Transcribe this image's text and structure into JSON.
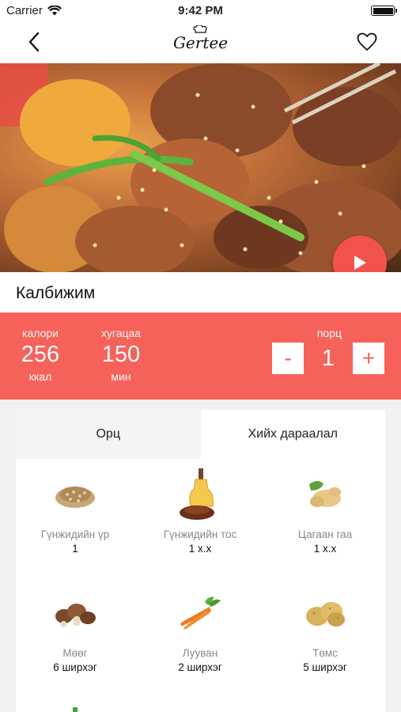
{
  "status_bar": {
    "carrier": "Carrier",
    "time": "9:42 PM"
  },
  "nav": {
    "logo_text": "Gertee"
  },
  "recipe": {
    "title": "Калбижим"
  },
  "stats": {
    "calorie_label": "калори",
    "calorie_value": "256",
    "calorie_unit": "ккал",
    "time_label": "хугацаа",
    "time_value": "150",
    "time_unit": "мин",
    "portion_label": "порц",
    "portion_value": "1",
    "minus_label": "-",
    "plus_label": "+"
  },
  "tabs": [
    {
      "label": "Орц",
      "active": true
    },
    {
      "label": "Хийх дараалал",
      "active": false
    }
  ],
  "ingredients": [
    {
      "name": "Гүнжидийн үр",
      "qty": "1",
      "icon": "sesame-seeds-icon"
    },
    {
      "name": "Гүнжидийн тос",
      "qty": "1 х.х",
      "icon": "sesame-oil-icon"
    },
    {
      "name": "Цагаан гаа",
      "qty": "1 х.х",
      "icon": "ginger-icon"
    },
    {
      "name": "Мөөг",
      "qty": "6 ширхэг",
      "icon": "mushroom-icon"
    },
    {
      "name": "Лууван",
      "qty": "2 ширхэг",
      "icon": "carrot-icon"
    },
    {
      "name": "Төмс",
      "qty": "5 ширхэг",
      "icon": "potato-icon"
    }
  ],
  "colors": {
    "accent": "#f6625a",
    "play": "#f2524d"
  }
}
